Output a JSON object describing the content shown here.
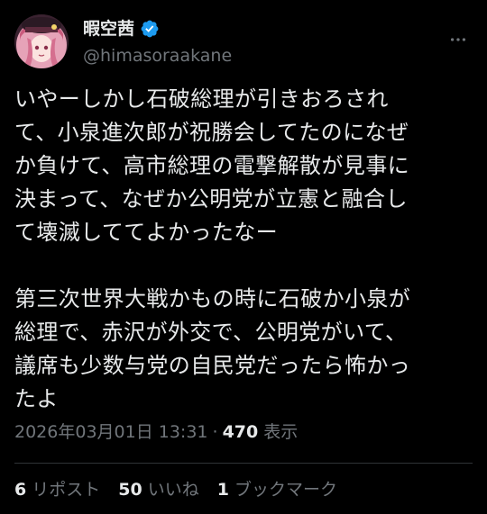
{
  "author": {
    "display_name": "暇空茜",
    "handle": "@himasoraakane",
    "verified": true
  },
  "tweet": {
    "paragraphs": [
      "いやーしかし石破総理が引きおろされて、小泉進次郎が祝勝会してたのになぜか負けて、高市総理の電撃解散が見事に決まって、なぜか公明党が立憲と融合して壊滅しててよかったなー",
      "第三次世界大戦かもの時に石破か小泉が総理で、赤沢が外交で、公明党がいて、議席も少数与党の自民党だったら怖かったよ"
    ],
    "lines_p1": [
      "いやーしかし石破総理が引きおろされ",
      "て、小泉進次郎が祝勝会してたのになぜ",
      "か負けて、高市総理の電撃解散が見事に",
      "決まって、なぜか公明党が立憲と融合し",
      "て壊滅しててよかったなー"
    ],
    "lines_p2": [
      "第三次世界大戦かもの時に石破か小泉が",
      "総理で、赤沢が外交で、公明党がいて、",
      "議席も少数与党の自民党だったら怖かっ",
      "たよ"
    ]
  },
  "meta": {
    "timestamp": "2026年03月01日 13:31",
    "separator": "·",
    "views_count": "470",
    "views_label": "表示"
  },
  "stats": {
    "reposts": {
      "count": "6",
      "label": "リポスト"
    },
    "likes": {
      "count": "50",
      "label": "いいね"
    },
    "bookmarks": {
      "count": "1",
      "label": "ブックマーク"
    }
  },
  "icons": {
    "verified": "verified-badge-icon",
    "more": "more-horizontal-icon"
  },
  "colors": {
    "background": "#000000",
    "text_primary": "#e7e9ea",
    "text_secondary": "#71767b",
    "verified_blue": "#1d9bf0",
    "divider": "#2f3336"
  }
}
